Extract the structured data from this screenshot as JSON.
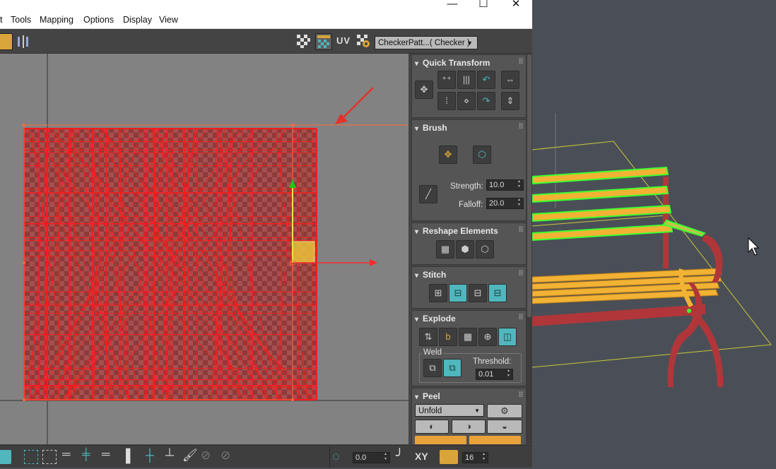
{
  "window": {
    "minimize_glyph": "—",
    "maximize_glyph": "☐",
    "close_glyph": "✕"
  },
  "menu": {
    "items": [
      "t",
      "Tools",
      "Mapping",
      "Options",
      "Display",
      "View"
    ]
  },
  "toolbar": {
    "uv_label": "UV",
    "texture_dropdown": "CheckerPatt...( Checker )"
  },
  "quick_transform": {
    "title": "Quick Transform"
  },
  "brush": {
    "title": "Brush",
    "strength_label": "Strength:",
    "strength_value": "10.0",
    "falloff_label": "Falloff:",
    "falloff_value": "20.0"
  },
  "reshape": {
    "title": "Reshape Elements"
  },
  "stitch": {
    "title": "Stitch"
  },
  "explode": {
    "title": "Explode",
    "weld_label": "Weld",
    "threshold_label": "Threshold:",
    "threshold_value": "0.01"
  },
  "peel": {
    "title": "Peel",
    "unfold_value": "Unfold"
  },
  "statusbar": {
    "angle_value": "0.0",
    "xy_label": "XY",
    "snap_value": "16"
  },
  "colors": {
    "uv_wire": "#ff1a1a",
    "gizmo_y": "#1ec81e",
    "gizmo_x": "#ff2a2a",
    "bench_wood": "#f2b233",
    "bench_frame": "#b0363a",
    "selection_green": "#3dff2e"
  }
}
